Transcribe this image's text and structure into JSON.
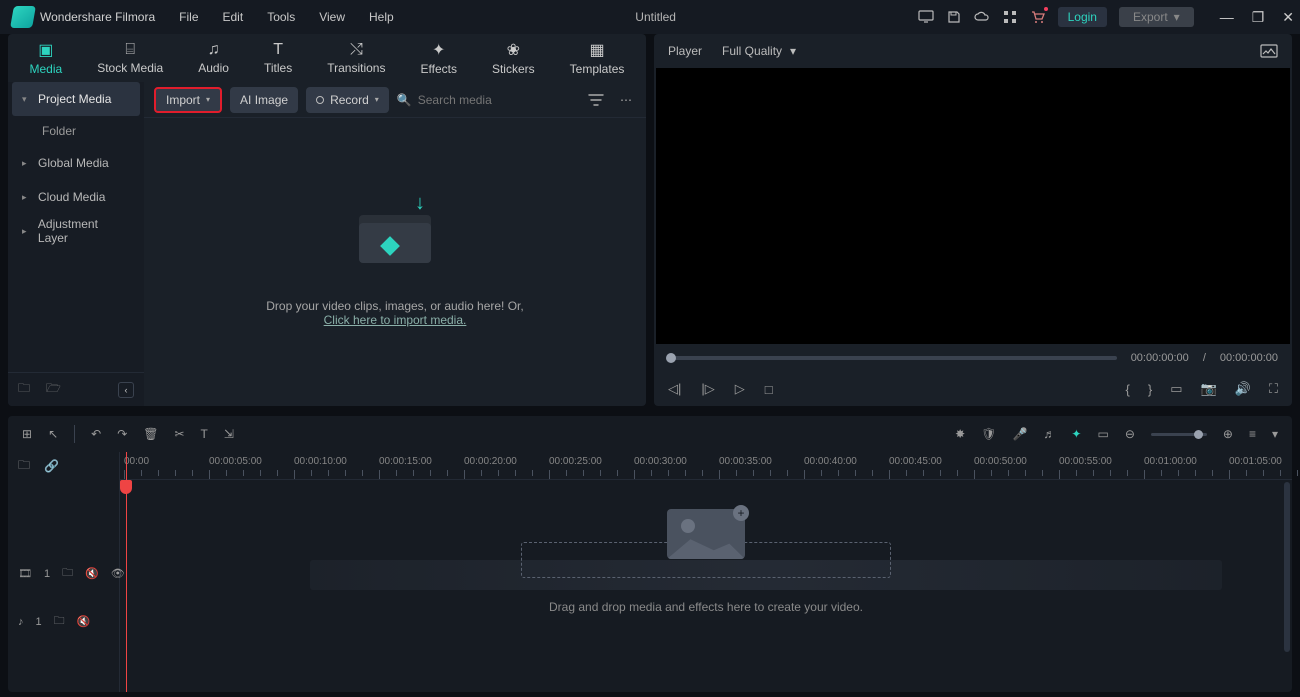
{
  "brand": "Wondershare Filmora",
  "menu": [
    "File",
    "Edit",
    "Tools",
    "View",
    "Help"
  ],
  "title": "Untitled",
  "login": "Login",
  "export": "Export",
  "tabs": [
    {
      "label": "Media",
      "icon": "▣"
    },
    {
      "label": "Stock Media",
      "icon": "⌸"
    },
    {
      "label": "Audio",
      "icon": "♪"
    },
    {
      "label": "Titles",
      "icon": "T"
    },
    {
      "label": "Transitions",
      "icon": "⇄"
    },
    {
      "label": "Effects",
      "icon": "✦"
    },
    {
      "label": "Stickers",
      "icon": "✿"
    },
    {
      "label": "Templates",
      "icon": "▧"
    }
  ],
  "sidebar": {
    "items": [
      {
        "label": "Project Media"
      },
      {
        "label": "Global Media"
      },
      {
        "label": "Cloud Media"
      },
      {
        "label": "Adjustment Layer"
      }
    ],
    "folder_label": "Folder"
  },
  "toolbar": {
    "import": "Import",
    "ai_image": "AI Image",
    "record": "Record",
    "search_placeholder": "Search media"
  },
  "dropzone": {
    "text": "Drop your video clips, images, or audio here! Or,",
    "link": "Click here to import media."
  },
  "player": {
    "label": "Player",
    "quality": "Full Quality",
    "time_current": "00:00:00:00",
    "time_sep": "/",
    "time_total": "00:00:00:00"
  },
  "ruler": [
    "00:00",
    "00:00:05:00",
    "00:00:10:00",
    "00:00:15:00",
    "00:00:20:00",
    "00:00:25:00",
    "00:00:30:00",
    "00:00:35:00",
    "00:00:40:00",
    "00:00:45:00",
    "00:00:50:00",
    "00:00:55:00",
    "00:01:00:00",
    "00:01:05:00"
  ],
  "timeline_drop": "Drag and drop media and effects here to create your video.",
  "track1_num": "1",
  "track2_num": "1"
}
